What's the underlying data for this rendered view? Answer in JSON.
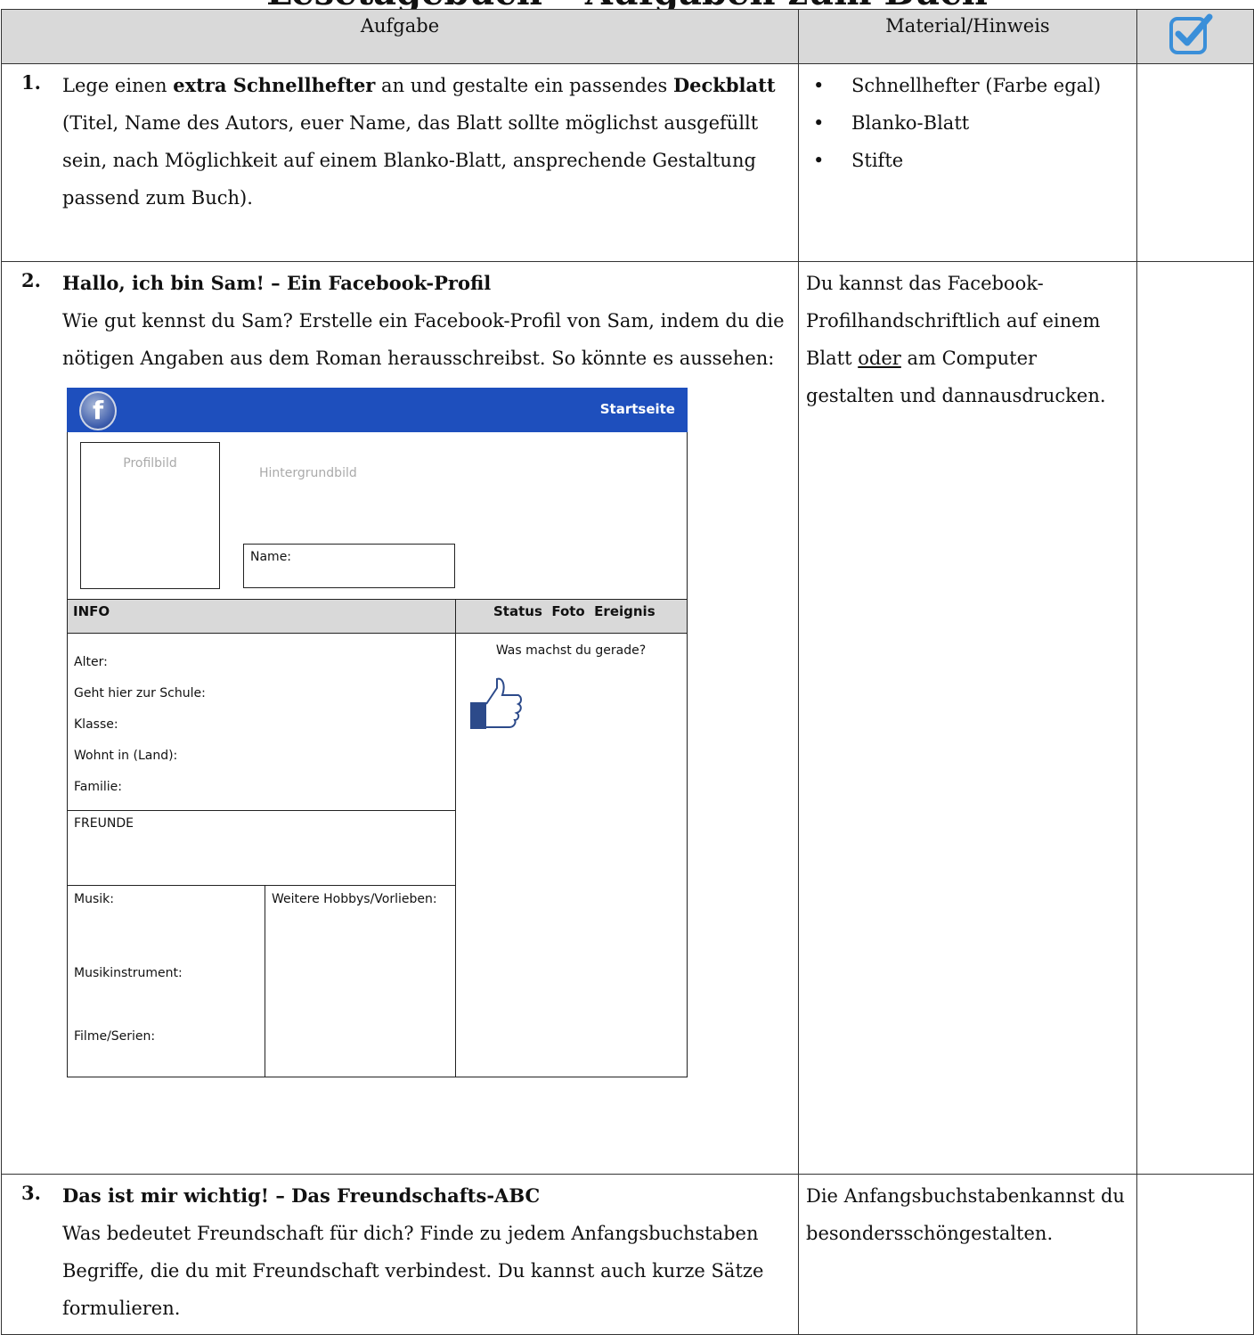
{
  "doc": {
    "title": "Lesetagebuch – Aufgaben zum Buch",
    "headers": {
      "task": "Aufgabe",
      "material": "Material/Hinweis"
    },
    "icons": {
      "check": "checkbox-checked-icon",
      "facebook": "facebook-logo-icon",
      "like": "thumbs-up-icon"
    },
    "accent_color": "#3a8fd9"
  },
  "tasks": [
    {
      "number": "1.",
      "text_before": "Lege einen ",
      "bold1": "extra Schnellhefter",
      "text_mid": " an und gestalte ein passendes ",
      "bold2": "Deckblatt",
      "text_after": " (Titel, Name des Autors, euer Name, das Blatt sollte möglichst ausgefüllt sein, nach Möglichkeit auf einem Blanko-Blatt, ansprechende Gestaltung passend zum Buch).",
      "materials": [
        "Schnellhefter (Farbe egal)",
        "Blanko-Blatt",
        "Stifte"
      ]
    },
    {
      "number": "2.",
      "title": "Hallo, ich bin Sam! – Ein Facebook-Profil",
      "text": "Wie gut kennst du Sam? Erstelle ein Facebook-Profil von Sam, indem du die nötigen Angaben aus dem Roman herausschreibst. So könnte es aussehen:",
      "hint_before": "Du kannst das Facebook-Profilhandschriftlich auf einem Blatt ",
      "hint_underlined": "oder",
      "hint_after": " am Computer gestalten und dannausdrucken."
    },
    {
      "number": "3.",
      "title": "Das ist mir wichtig! – Das Freundschafts-ABC",
      "text": "Was bedeutet Freundschaft für dich? Finde zu jedem Anfangsbuchstaben Begriffe, die du mit Freundschaft verbindest. Du kannst auch kurze Sätze formulieren.",
      "hint": "Die Anfangsbuchstabenkannst du besondersschöngestalten."
    }
  ],
  "facebook": {
    "header_link": "Startseite",
    "profile_pic": "Profilbild",
    "background_pic": "Hintergrundbild",
    "name_label": "Name:",
    "info_heading": "INFO",
    "status_tabs": "Status  Foto  Ereignis",
    "status_prompt": "Was machst du gerade?",
    "info_fields": [
      "Alter:",
      "Geht hier zur Schule:",
      "Klasse:",
      "Wohnt in (Land):",
      "Familie:"
    ],
    "friends_heading": "FREUNDE",
    "music_label": "Musik:",
    "instrument_label": "Musikinstrument:",
    "movies_label": "Filme/Serien:",
    "hobbies_label": "Weitere Hobbys/Vorlieben:"
  }
}
